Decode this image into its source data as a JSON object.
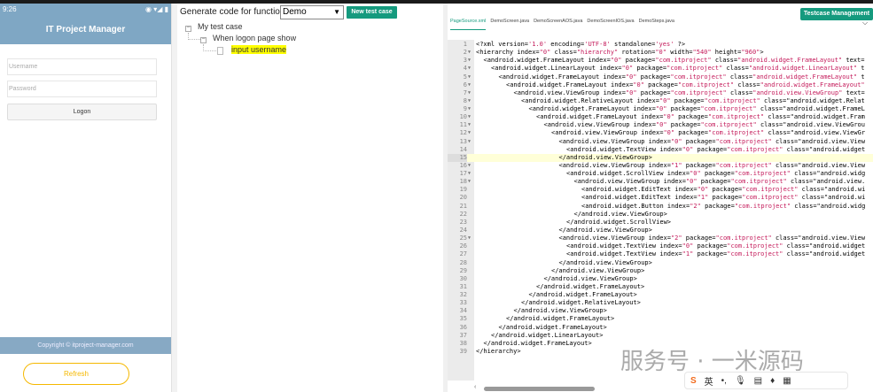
{
  "phone": {
    "time": "9:26",
    "app_title": "IT Project Manager",
    "username_placeholder": "Username",
    "password_placeholder": "Password",
    "logon": "Logon",
    "copyright": "Copyright © itproject-manager.com",
    "refresh": "Refresh"
  },
  "middle": {
    "generate_label": "Generate code for function:",
    "function_selected": "Demo",
    "new_test_case": "New test case",
    "tree": [
      {
        "label": "My test case"
      },
      {
        "label": "When logon page show"
      },
      {
        "label": "input username"
      }
    ]
  },
  "right": {
    "testcase_management": "Testcase Management",
    "tabs": [
      "PageSource.xml",
      "DemoScreen.java",
      "DemoScreenAOS.java",
      "DemoScreenIOS.java",
      "DemoSteps.java"
    ],
    "active_tab": 0,
    "current_line": 15,
    "lines": [
      [
        0,
        "<?xml version='1.0' encoding='UTF-8' standalone='yes' ?>",
        0
      ],
      [
        0,
        "<hierarchy index=\"0\" class=\"hierarchy\" rotation=\"0\" width=\"540\" height=\"960\">",
        1
      ],
      [
        1,
        "<android.widget.FrameLayout index=\"0\" package=\"com.itproject\" class=\"android.widget.FrameLayout\" text=",
        1
      ],
      [
        2,
        "<android.widget.LinearLayout index=\"0\" package=\"com.itproject\" class=\"android.widget.LinearLayout\" t",
        1
      ],
      [
        3,
        "<android.widget.FrameLayout index=\"0\" package=\"com.itproject\" class=\"android.widget.FrameLayout\" t",
        1
      ],
      [
        4,
        "<android.widget.FrameLayout index=\"0\" package=\"com.itproject\" class=\"android.widget.FrameLayout\"",
        1
      ],
      [
        5,
        "<android.view.ViewGroup index=\"0\" package=\"com.itproject\" class=\"android.view.ViewGroup\" text=",
        1
      ],
      [
        6,
        "<android.widget.RelativeLayout index=\"0\" package=\"com.itproject\" class=\"android.widget.Relat",
        1
      ],
      [
        7,
        "<android.widget.FrameLayout index=\"0\" package=\"com.itproject\" class=\"android.widget.FrameL",
        1
      ],
      [
        8,
        "<android.widget.FrameLayout index=\"0\" package=\"com.itproject\" class=\"android.widget.Fram",
        1
      ],
      [
        9,
        "<android.view.ViewGroup index=\"0\" package=\"com.itproject\" class=\"android.view.ViewGrou",
        1
      ],
      [
        10,
        "<android.view.ViewGroup index=\"0\" package=\"com.itproject\" class=\"android.view.ViewGr",
        1
      ],
      [
        11,
        "<android.view.ViewGroup index=\"0\" package=\"com.itproject\" class=\"android.view.View",
        1
      ],
      [
        12,
        "<android.widget.TextView index=\"0\" package=\"com.itproject\" class=\"android.widget",
        0
      ],
      [
        11,
        "</android.view.ViewGroup>",
        0
      ],
      [
        11,
        "<android.view.ViewGroup index=\"1\" package=\"com.itproject\" class=\"android.view.View",
        1
      ],
      [
        12,
        "<android.widget.ScrollView index=\"0\" package=\"com.itproject\" class=\"android.widg",
        1
      ],
      [
        13,
        "<android.view.ViewGroup index=\"0\" package=\"com.itproject\" class=\"android.view.",
        1
      ],
      [
        14,
        "<android.widget.EditText index=\"0\" package=\"com.itproject\" class=\"android.wi",
        0
      ],
      [
        14,
        "<android.widget.EditText index=\"1\" package=\"com.itproject\" class=\"android.wi",
        0
      ],
      [
        14,
        "<android.widget.Button index=\"2\" package=\"com.itproject\" class=\"android.widg",
        0
      ],
      [
        13,
        "</android.view.ViewGroup>",
        0
      ],
      [
        12,
        "</android.widget.ScrollView>",
        0
      ],
      [
        11,
        "</android.view.ViewGroup>",
        0
      ],
      [
        11,
        "<android.view.ViewGroup index=\"2\" package=\"com.itproject\" class=\"android.view.View",
        1
      ],
      [
        12,
        "<android.widget.TextView index=\"0\" package=\"com.itproject\" class=\"android.widget",
        0
      ],
      [
        12,
        "<android.widget.TextView index=\"1\" package=\"com.itproject\" class=\"android.widget",
        0
      ],
      [
        11,
        "</android.view.ViewGroup>",
        0
      ],
      [
        10,
        "</android.view.ViewGroup>",
        0
      ],
      [
        9,
        "</android.view.ViewGroup>",
        0
      ],
      [
        8,
        "</android.widget.FrameLayout>",
        0
      ],
      [
        7,
        "</android.widget.FrameLayout>",
        0
      ],
      [
        6,
        "</android.widget.RelativeLayout>",
        0
      ],
      [
        5,
        "</android.view.ViewGroup>",
        0
      ],
      [
        4,
        "</android.widget.FrameLayout>",
        0
      ],
      [
        3,
        "</android.widget.FrameLayout>",
        0
      ],
      [
        2,
        "</android.widget.LinearLayout>",
        0
      ],
      [
        1,
        "</android.widget.FrameLayout>",
        0
      ],
      [
        0,
        "</hierarchy>",
        0
      ]
    ]
  },
  "watermark": "服务号 · 一米源码",
  "ime": {
    "lang": "英"
  }
}
